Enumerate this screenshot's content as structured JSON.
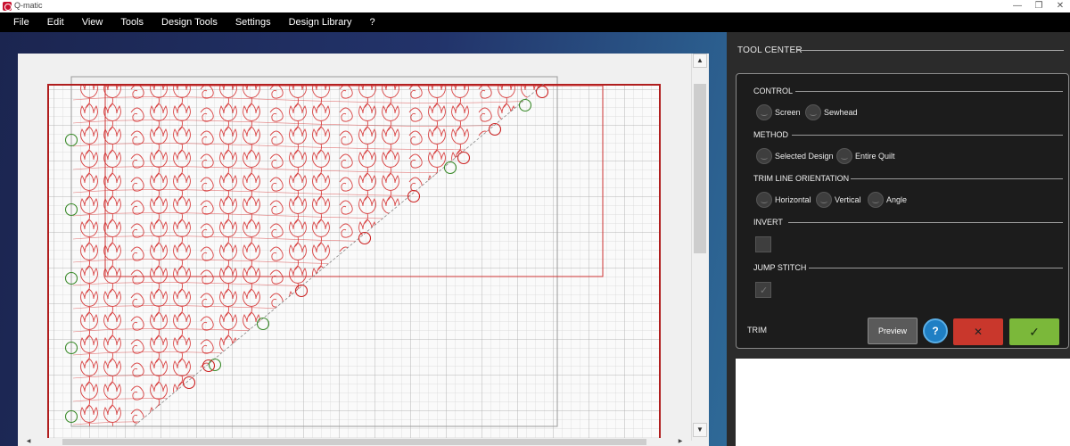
{
  "window": {
    "title": "Q-matic",
    "minimize": "—",
    "maximize": "❐",
    "close": "✕"
  },
  "menu": [
    "File",
    "Edit",
    "View",
    "Tools",
    "Design Tools",
    "Settings",
    "Design Library",
    "?"
  ],
  "canvas": {
    "stitch_color": "#d94545",
    "border_color": "#b01e1e",
    "marker_red": "#cc2222",
    "marker_green": "#3a8a2a",
    "grid_color": "#c8c8c8"
  },
  "scroll": {
    "up": "▲",
    "down": "▼",
    "left": "◀",
    "right": "▶"
  },
  "tool_center": {
    "title": "TOOL CENTER",
    "control": {
      "label": "CONTROL",
      "options": [
        "Screen",
        "Sewhead"
      ]
    },
    "method": {
      "label": "METHOD",
      "options": [
        "Selected Design",
        "Entire Quilt"
      ]
    },
    "trim_line_orientation": {
      "label": "TRIM LINE ORIENTATION",
      "options": [
        "Horizontal",
        "Vertical",
        "Angle"
      ]
    },
    "invert": {
      "label": "INVERT",
      "checked": false
    },
    "jump_stitch": {
      "label": "JUMP STITCH",
      "checked": true,
      "mark": "✓"
    },
    "trim_label": "TRIM",
    "preview_label": "Preview",
    "help_label": "?",
    "cancel_label": "✕",
    "ok_label": "✓"
  }
}
